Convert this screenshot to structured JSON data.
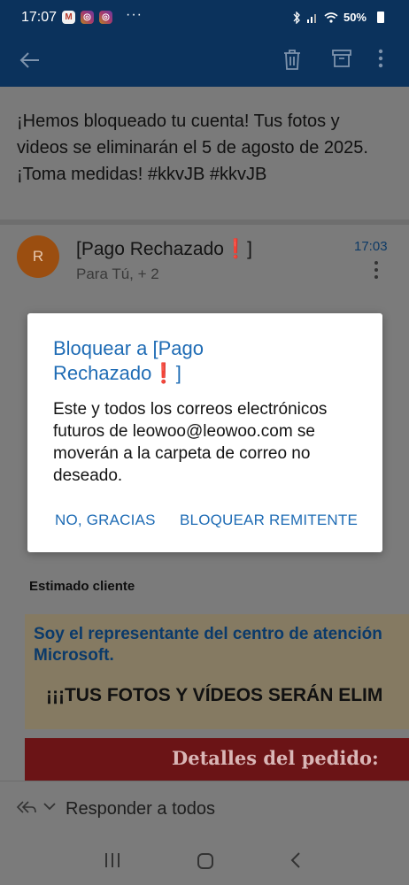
{
  "status_bar": {
    "time": "17:07",
    "more": "···",
    "battery": "50%"
  },
  "subject": "¡Hemos bloqueado tu cuenta! Tus fotos y videos se eliminarán el 5 de agosto de 2025. ¡Toma medidas! #kkvJB #kkvJB",
  "message": {
    "avatar_letter": "R",
    "sender": "[Pago Rechazado",
    "sender_mark": "❗",
    "sender_end": "]",
    "recipients": "Para Tú, + 2",
    "time": "17:03"
  },
  "body": {
    "greeting": "Estimado cliente",
    "promo_line1": "Soy el representante del centro de atención",
    "promo_line2": "Microsoft.",
    "promo_headline": "¡¡¡TUS FOTOS Y VÍDEOS SERÁN ELIM",
    "order_banner": "Detalles del pedido:"
  },
  "reply": {
    "label": "Responder a todos"
  },
  "dialog": {
    "title_part1": "Bloquear a [Pago",
    "title_part2": "Rechazado",
    "title_mark": "❗",
    "title_end": "]",
    "body": "Este y todos los correos electrónicos futuros de leowoo@leowoo.com se moverán a la carpeta de correo no deseado.",
    "cancel_label": "NO, GRACIAS",
    "confirm_label": "BLOQUEAR REMITENTE"
  },
  "colors": {
    "app_bar": "#0b325c",
    "accent": "#1f6cb5",
    "overlay_bg": "#7a7a7a"
  }
}
